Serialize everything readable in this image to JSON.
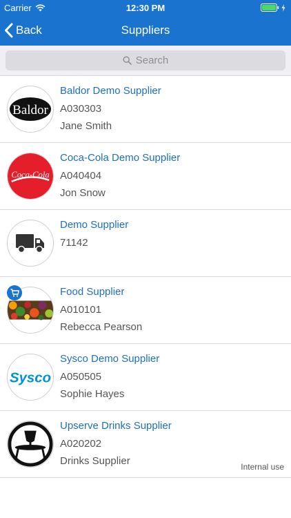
{
  "status_bar": {
    "carrier": "Carrier",
    "time": "12:30 PM"
  },
  "nav": {
    "back_label": "Back",
    "title": "Suppliers"
  },
  "search": {
    "placeholder": "Search"
  },
  "suppliers": [
    {
      "name": "Baldor Demo Supplier",
      "code": "A030303",
      "contact": "Jane Smith",
      "logo_text": "Baldor",
      "tag": ""
    },
    {
      "name": "Coca-Cola Demo Supplier",
      "code": "A040404",
      "contact": "Jon Snow",
      "logo_text": "Coca-Cola",
      "tag": ""
    },
    {
      "name": "Demo Supplier",
      "code": "71142",
      "contact": "",
      "logo_text": "",
      "tag": ""
    },
    {
      "name": "Food Supplier",
      "code": "A010101",
      "contact": "Rebecca Pearson",
      "logo_text": "",
      "tag": ""
    },
    {
      "name": "Sysco Demo Supplier",
      "code": "A050505",
      "contact": "Sophie Hayes",
      "logo_text": "Sysco",
      "tag": ""
    },
    {
      "name": "Upserve Drinks Supplier",
      "code": "A020202",
      "contact": "Drinks Supplier",
      "logo_text": "",
      "tag": "Internal use"
    }
  ],
  "icons": {
    "wifi": "wifi-icon",
    "battery": "battery-icon",
    "charging": "bolt-icon",
    "back": "chevron-left-icon",
    "search": "search-icon",
    "truck": "truck-icon",
    "cart": "cart-icon",
    "drinks": "glass-icon"
  },
  "colors": {
    "brand_blue": "#1a73cf",
    "link_blue": "#1f6fc0",
    "battery_green": "#4cd964",
    "coca_red": "#e41e2b",
    "sysco_blue": "#0093d0"
  }
}
